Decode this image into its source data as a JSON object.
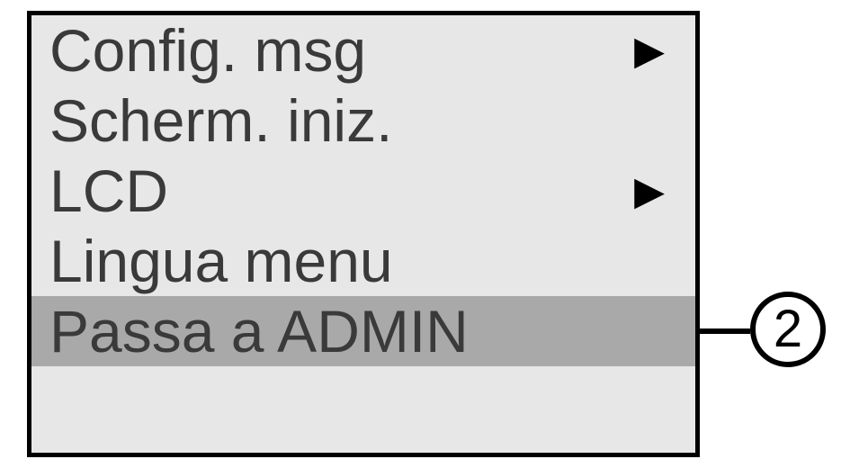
{
  "menu": {
    "items": [
      {
        "label": "Config. msg",
        "hasSubmenu": true,
        "selected": false
      },
      {
        "label": "Scherm. iniz.",
        "hasSubmenu": false,
        "selected": false
      },
      {
        "label": "LCD",
        "hasSubmenu": true,
        "selected": false
      },
      {
        "label": "Lingua menu",
        "hasSubmenu": false,
        "selected": false
      },
      {
        "label": "Passa a ADMIN",
        "hasSubmenu": false,
        "selected": true
      }
    ]
  },
  "callout": {
    "number": "2"
  }
}
